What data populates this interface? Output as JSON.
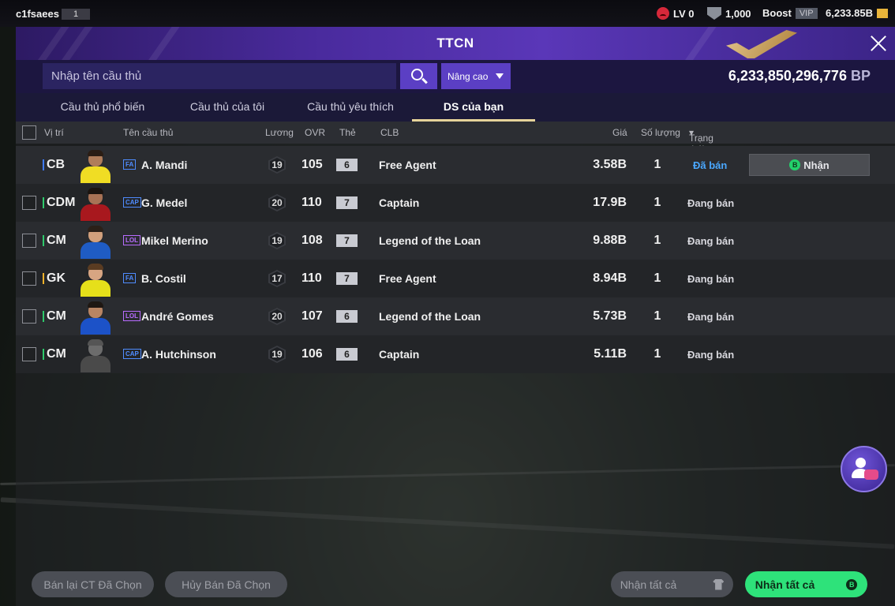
{
  "topbar": {
    "username": "c1fsaees",
    "level": "1",
    "lv": "LV 0",
    "shield_count": "1,000",
    "boost": "Boost",
    "vip": "VIP",
    "balance": "6,233.85B"
  },
  "panel": {
    "title": "TTCN",
    "search_placeholder": "Nhập tên cầu thủ",
    "advanced": "Nâng cao",
    "bp_amount": "6,233,850,296,776",
    "bp_unit": "BP"
  },
  "tabs": [
    {
      "label": "Cầu thủ phổ biến"
    },
    {
      "label": "Cầu thủ của tôi"
    },
    {
      "label": "Cầu thủ yêu thích"
    },
    {
      "label": "DS của bạn"
    }
  ],
  "columns": {
    "position": "Vị trí",
    "name": "Tên cầu thủ",
    "salary": "Lương",
    "ovr": "OVR",
    "grade": "Thẻ",
    "club": "CLB",
    "price": "Giá",
    "quantity": "Số lượng",
    "status": "Trạng thái"
  },
  "rows": [
    {
      "position": "CB",
      "pos_color": "#3f7bff",
      "season": "FA",
      "season_color": "#4f8cff",
      "name": "A. Mandi",
      "salary": "19",
      "ovr": "105",
      "grade": "6",
      "club": "Free Agent",
      "price": "3.58B",
      "quantity": "1",
      "status": "Đã bán",
      "sold": true,
      "action": "Nhận",
      "skin": "#b07d5a",
      "hair": "#2a1d14",
      "kit": "#f0dd24"
    },
    {
      "position": "CDM",
      "pos_color": "#2ec96a",
      "season": "CAP",
      "season_color": "#4f8cff",
      "name": "G. Medel",
      "salary": "20",
      "ovr": "110",
      "grade": "7",
      "club": "Captain",
      "price": "17.9B",
      "quantity": "1",
      "status": "Đang bán",
      "sold": false,
      "skin": "#a87255",
      "hair": "#1b1410",
      "kit": "#a8181e"
    },
    {
      "position": "CM",
      "pos_color": "#2ec96a",
      "season": "LOL",
      "season_color": "#b86cff",
      "name": "Mikel Merino",
      "salary": "19",
      "ovr": "108",
      "grade": "7",
      "club": "Legend of the Loan",
      "price": "9.88B",
      "quantity": "1",
      "status": "Đang bán",
      "sold": false,
      "skin": "#d2a07c",
      "hair": "#2b2018",
      "kit": "#1f5cc4"
    },
    {
      "position": "GK",
      "pos_color": "#f0b12a",
      "season": "FA",
      "season_color": "#4f8cff",
      "name": "B. Costil",
      "salary": "17",
      "ovr": "110",
      "grade": "7",
      "club": "Free Agent",
      "price": "8.94B",
      "quantity": "1",
      "status": "Đang bán",
      "sold": false,
      "skin": "#d7a582",
      "hair": "#5a3c22",
      "kit": "#e6e01a"
    },
    {
      "position": "CM",
      "pos_color": "#2ec96a",
      "season": "LOL",
      "season_color": "#b86cff",
      "name": "André Gomes",
      "salary": "20",
      "ovr": "107",
      "grade": "6",
      "club": "Legend of the Loan",
      "price": "5.73B",
      "quantity": "1",
      "status": "Đang bán",
      "sold": false,
      "skin": "#b98563",
      "hair": "#1e1712",
      "kit": "#1c52c8"
    },
    {
      "position": "CM",
      "pos_color": "#2ec96a",
      "season": "CAP",
      "season_color": "#4f8cff",
      "name": "A. Hutchinson",
      "salary": "19",
      "ovr": "106",
      "grade": "6",
      "club": "Captain",
      "price": "5.11B",
      "quantity": "1",
      "status": "Đang bán",
      "sold": false,
      "skin": "#6c6c6c",
      "hair": "#555555",
      "kit": "#4a4a4a"
    }
  ],
  "footer": {
    "resell_selected": "Bán lại CT Đã Chọn",
    "cancel_selected": "Hủy Bán Đã Chọn",
    "receive_all_disabled": "Nhận tất cả",
    "receive_all": "Nhận tất cả"
  },
  "icons": {
    "b_coin": "B"
  }
}
